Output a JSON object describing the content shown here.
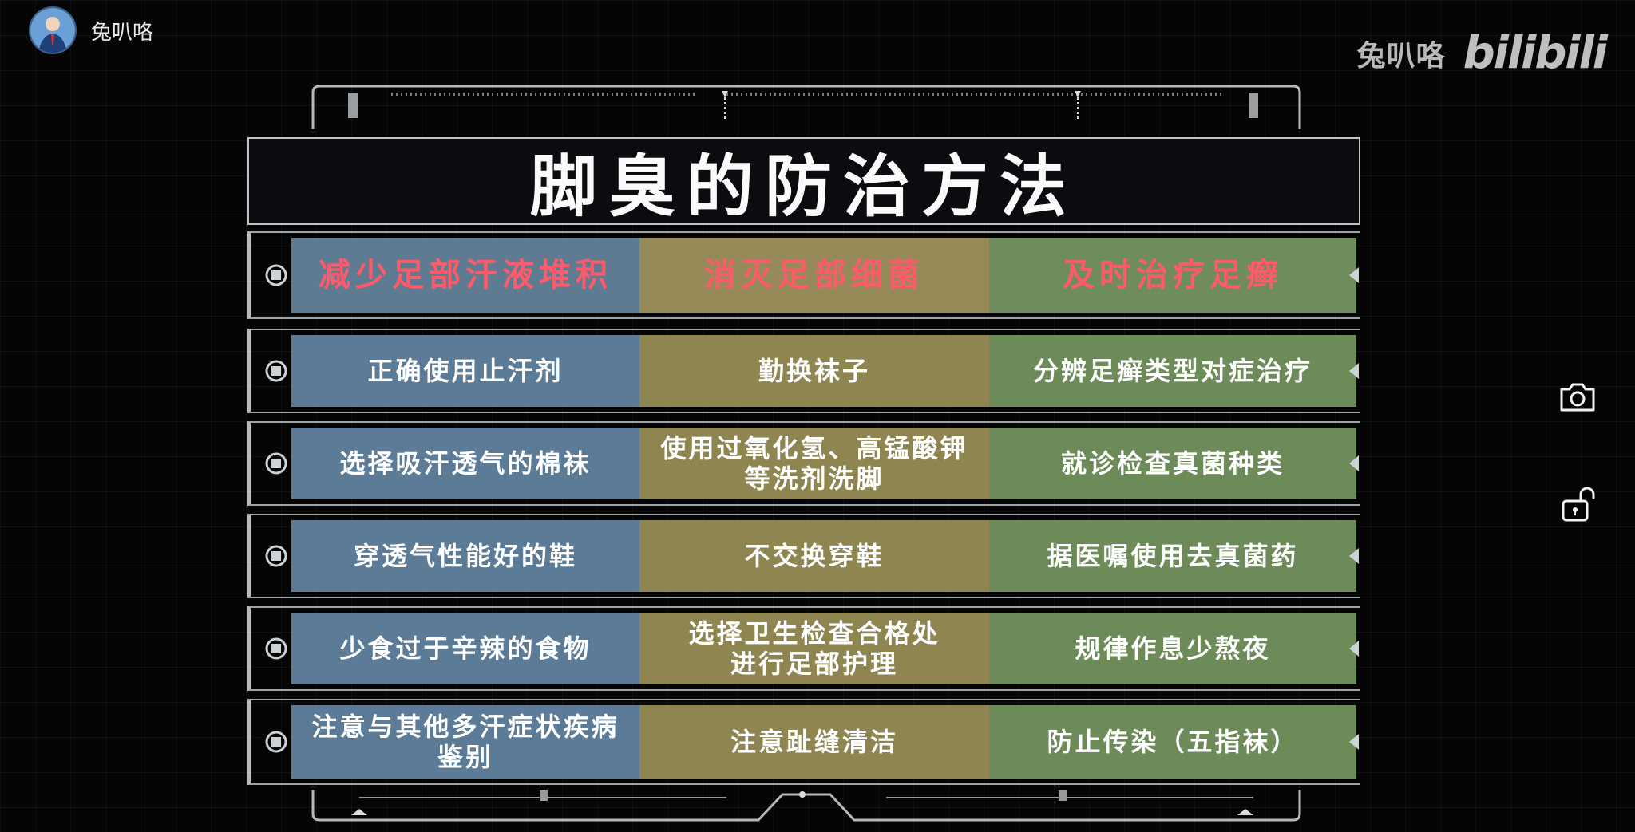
{
  "uploader": {
    "name": "兔叭咯"
  },
  "watermark": {
    "name": "兔叭咯",
    "logo": "bilibili"
  },
  "title": "脚臭的防治方法",
  "columns": [
    "减少足部汗液堆积",
    "消灭足部细菌",
    "及时治疗足癣"
  ],
  "rows": [
    [
      "正确使用止汗剂",
      "勤换袜子",
      "分辨足癣类型对症治疗"
    ],
    [
      "选择吸汗透气的棉袜",
      "使用过氧化氢、高锰酸钾\n等洗剂洗脚",
      "就诊检查真菌种类"
    ],
    [
      "穿透气性能好的鞋",
      "不交换穿鞋",
      "据医嘱使用去真菌药"
    ],
    [
      "少食过于辛辣的食物",
      "选择卫生检查合格处\n进行足部护理",
      "规律作息少熬夜"
    ],
    [
      "注意与其他多汗症状疾病\n鉴别",
      "注意趾缝清洁",
      "防止传染（五指袜）"
    ]
  ],
  "icons": {
    "camera": "camera-icon",
    "lock": "unlock-icon",
    "row_marker": "target-icon"
  },
  "colors": {
    "col1": "#5b7b96",
    "col2": "#8e8551",
    "col3": "#6d8b58",
    "header_text": "#ff5a6a"
  }
}
